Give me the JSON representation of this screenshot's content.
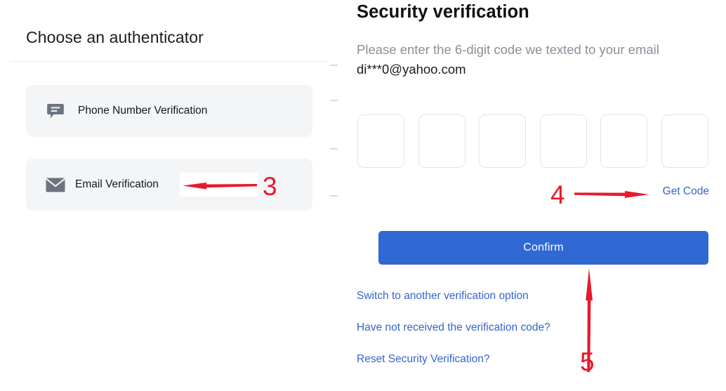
{
  "left_panel": {
    "title": "Choose an authenticator",
    "options": [
      {
        "label": "Phone Number Verification",
        "icon": "message-bubble-icon"
      },
      {
        "label": "Email Verification",
        "icon": "envelope-icon"
      }
    ]
  },
  "right_panel": {
    "title": "Security verification",
    "subtitle_prefix": "Please enter the 6-digit code we texted to your email ",
    "subtitle_email": "di***0@yahoo.com",
    "code_inputs": {
      "count": 6,
      "values": [
        "",
        "",
        "",
        "",
        "",
        ""
      ],
      "placeholder": ""
    },
    "get_code_label": "Get Code",
    "confirm_label": "Confirm",
    "helper_links": [
      "Switch to another verification option",
      "Have not received the verification code?",
      "Reset Security Verification?"
    ]
  },
  "annotations": [
    {
      "number": "3",
      "direction": "left",
      "target": "Email Verification"
    },
    {
      "number": "4",
      "direction": "right",
      "target": "Get Code"
    },
    {
      "number": "5",
      "direction": "up",
      "target": "Confirm"
    }
  ],
  "colors": {
    "accent_blue": "#3069d3",
    "link_blue": "#3366cc",
    "annotation_red": "#e8192c",
    "card_bg": "#f4f5f7",
    "muted_text": "#8a8f98",
    "border_gray": "#e4e5e8"
  }
}
